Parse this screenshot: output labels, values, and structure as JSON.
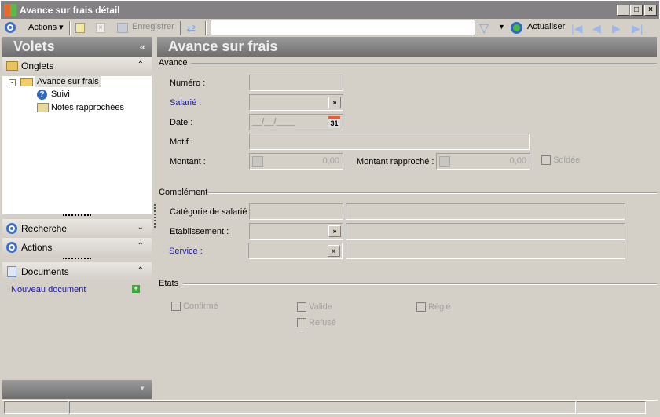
{
  "window": {
    "title": "Avance sur frais détail",
    "min": "_",
    "max": "□",
    "close": "×"
  },
  "toolbar": {
    "actions": "Actions ▾",
    "save": "Enregistrer",
    "search_value": "",
    "refresh": "Actualiser",
    "nav": [
      "|◀",
      "◀",
      "▶",
      "▶|"
    ]
  },
  "sidebar": {
    "title": "Volets",
    "collapse": "«",
    "onglets": "Onglets",
    "tree": {
      "root": "Avance sur frais",
      "children": [
        "Suivi",
        "Notes rapprochées"
      ]
    },
    "recherche": "Recherche",
    "actions": "Actions",
    "documents": "Documents",
    "new_document": "Nouveau document"
  },
  "main": {
    "title": "Avance sur frais",
    "avance": {
      "legend": "Avance",
      "numero": "Numéro :",
      "salarie": "Salarié :",
      "date": "Date  :",
      "date_value": "__/__/____",
      "motif": "Motif :",
      "montant": "Montant :",
      "montant_value": "0,00",
      "montant_rapproche": "Montant rapproché :",
      "montant_rapproche_value": "0,00",
      "soldee": "Soldée"
    },
    "complement": {
      "legend": "Complément",
      "categorie": "Catégorie de salarié",
      "etablissement": "Etablissement :",
      "service": "Service :"
    },
    "etats": {
      "legend": "Etats",
      "confirme": "Confirmé",
      "valide": "Valide",
      "regle": "Réglé",
      "refuse": "Refusé"
    }
  },
  "colors": {
    "link": "#1a1aa8",
    "header": "#7f7f7f"
  }
}
